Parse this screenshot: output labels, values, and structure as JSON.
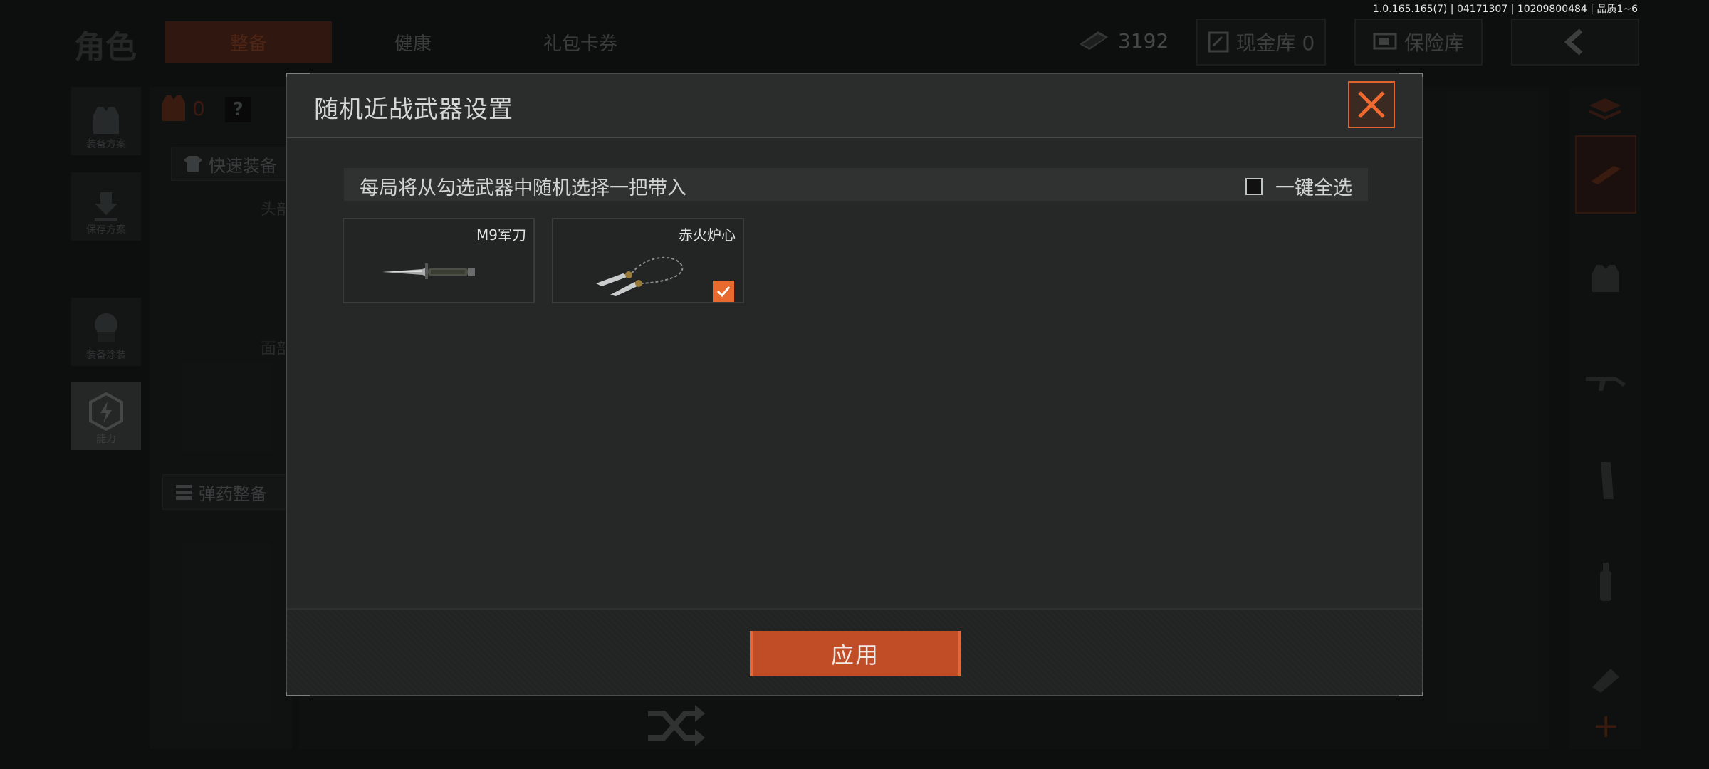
{
  "version_info": "1.0.165.165(7) | 04171307 | 10209800484 | 品质1~6",
  "background": {
    "title": "角色",
    "tabs": [
      "整备",
      "健康",
      "礼包卡券"
    ],
    "money_value": "3192",
    "cash_vault_label": "现金库 0",
    "safe_label": "保险库",
    "left_rail": [
      {
        "label": "装备方案"
      },
      {
        "label": "保存方案"
      },
      {
        "label": "装备涂装"
      },
      {
        "label": "能力"
      }
    ],
    "armor_count": "0",
    "help_label": "?",
    "quick_equip_label": "快速装备",
    "ammo_label": "弹药整备",
    "head_label": "头部",
    "face_label": "面部"
  },
  "modal": {
    "title": "随机近战武器设置",
    "info_text": "每局将从勾选武器中随机选择一把带入",
    "select_all_label": "一键全选",
    "weapons": [
      {
        "name": "M9军刀",
        "checked": false
      },
      {
        "name": "赤火炉心",
        "checked": true
      }
    ],
    "apply_label": "应用"
  },
  "colors": {
    "accent": "#e86a2e",
    "apply_bg": "#c04d26",
    "modal_bg": "#262828"
  }
}
